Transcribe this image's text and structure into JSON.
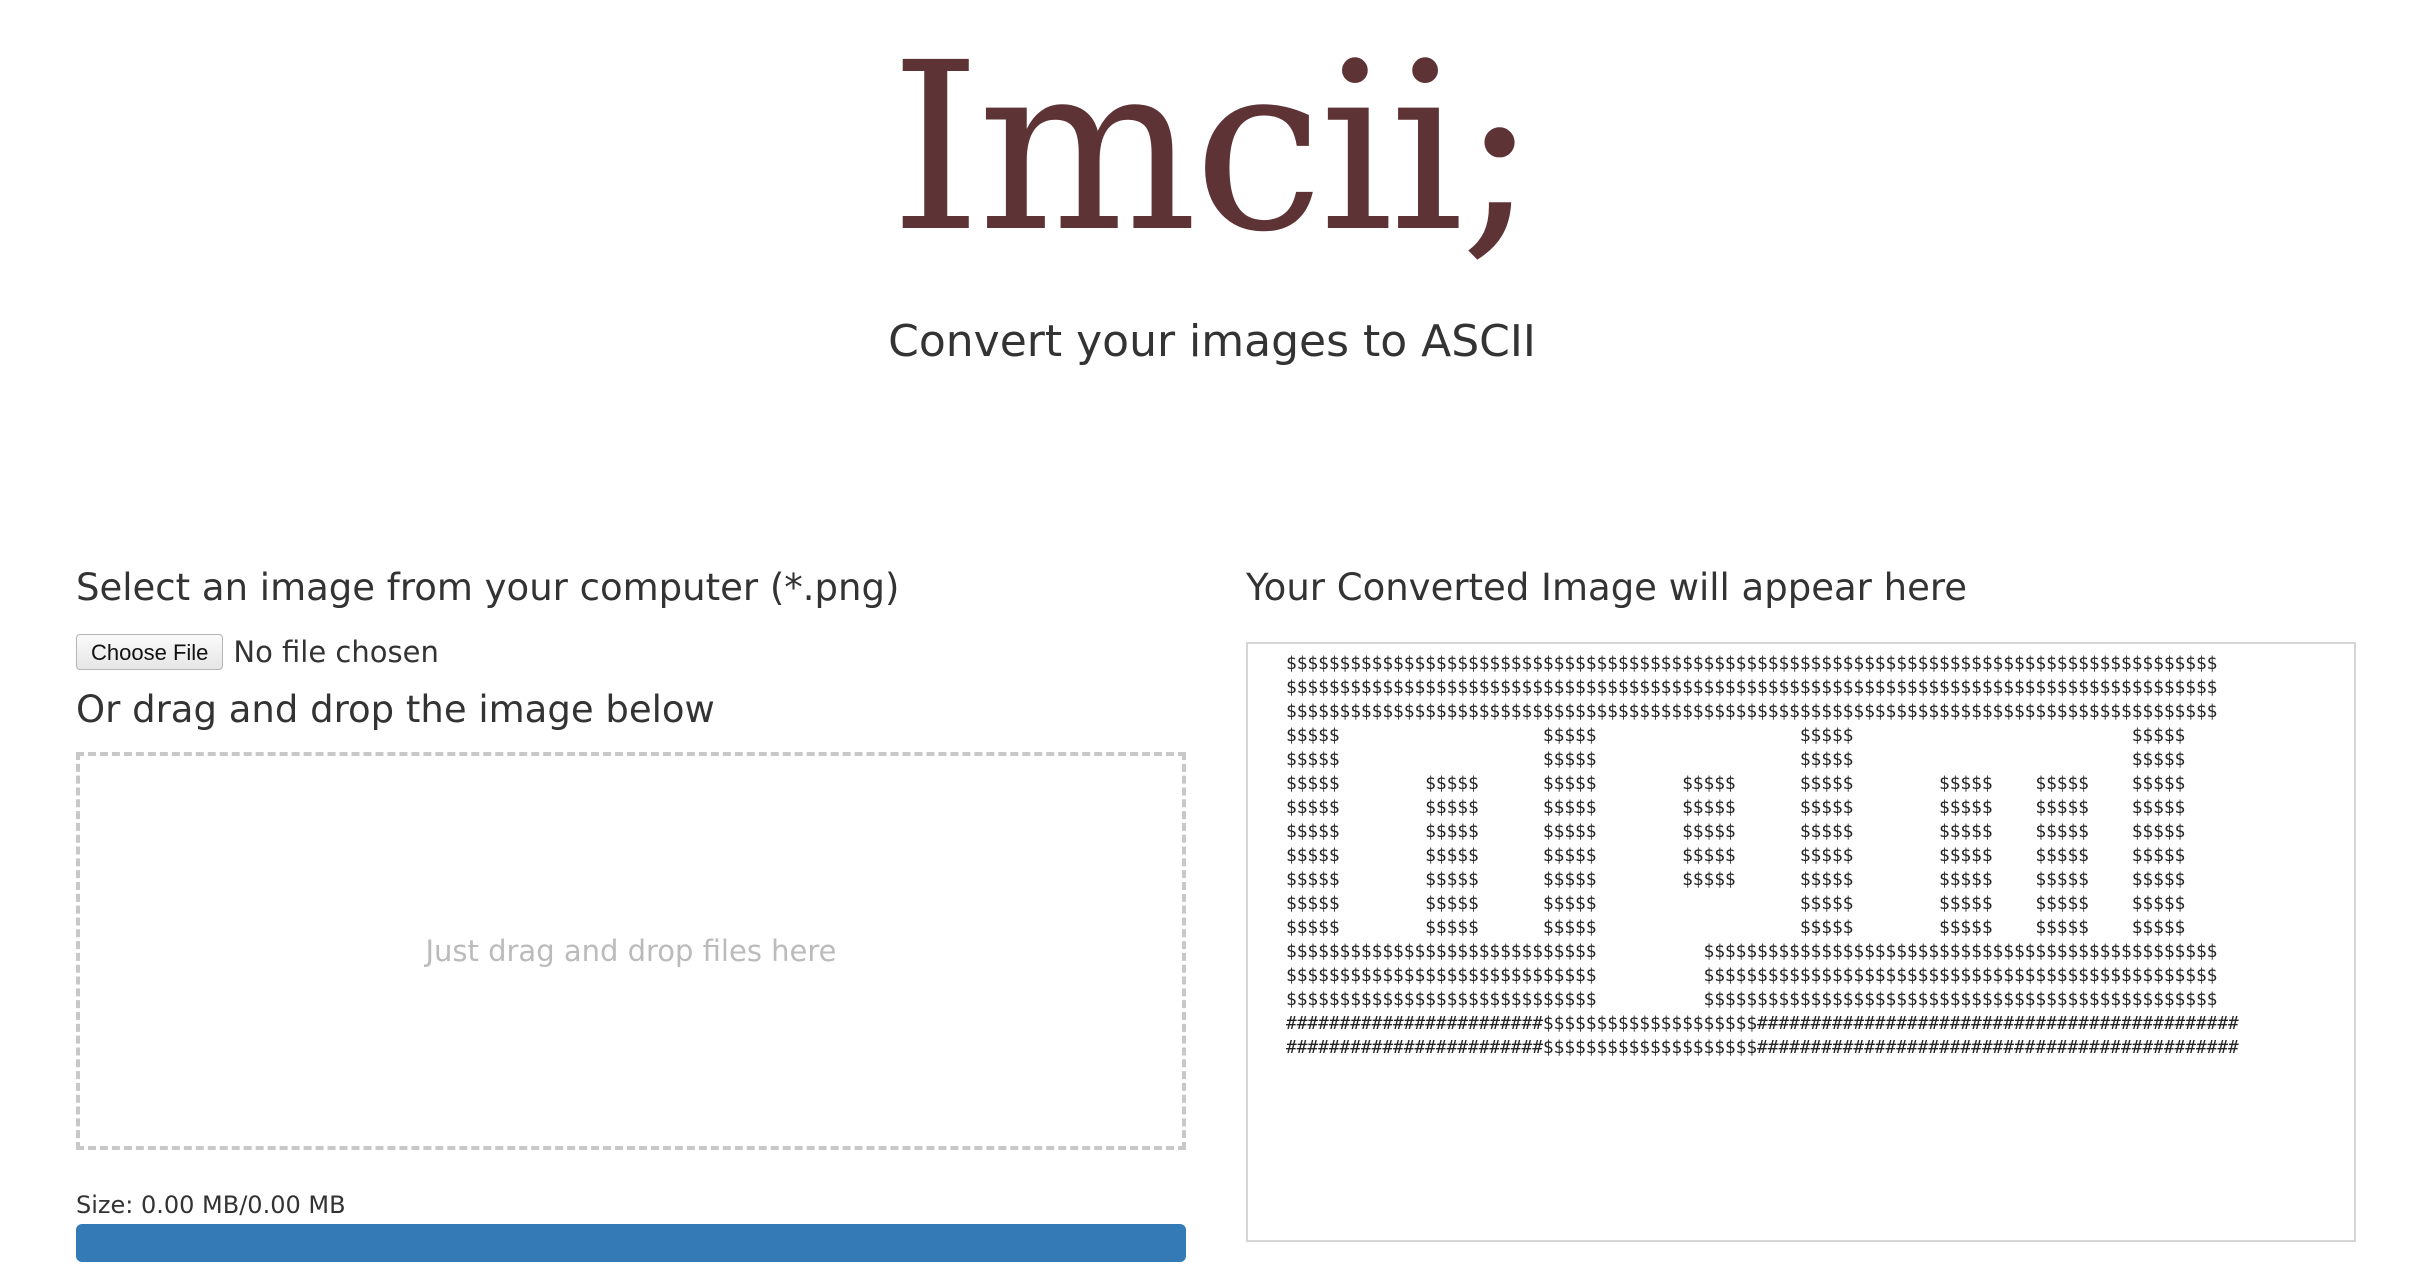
{
  "header": {
    "logo_text": "Imcii;",
    "tagline": "Convert your images to ASCII"
  },
  "upload": {
    "select_title": "Select an image from your computer (*.png)",
    "choose_file_label": "Choose File",
    "file_status": "No file chosen",
    "drag_title": "Or drag and drop the image below",
    "dropzone_hint": "Just drag and drop files here",
    "size_label": "Size: 0.00 MB/0.00 MB",
    "progress_fraction": 1.0
  },
  "output": {
    "title": "Your Converted Image will appear here",
    "ascii_lines": [
      "$$$$$$$$$$$$$$$$$$$$$$$$$$$$$$$$$$$$$$$$$$$$$$$$$$$$$$$$$$$$$$$$$$$$$$$$$$$$$$$$$$$$$$$",
      "$$$$$$$$$$$$$$$$$$$$$$$$$$$$$$$$$$$$$$$$$$$$$$$$$$$$$$$$$$$$$$$$$$$$$$$$$$$$$$$$$$$$$$$",
      "$$$$$$$$$$$$$$$$$$$$$$$$$$$$$$$$$$$$$$$$$$$$$$$$$$$$$$$$$$$$$$$$$$$$$$$$$$$$$$$$$$$$$$$",
      "$$$$$                   $$$$$                   $$$$$                          $$$$$",
      "$$$$$                   $$$$$                   $$$$$                          $$$$$",
      "$$$$$        $$$$$      $$$$$        $$$$$      $$$$$        $$$$$    $$$$$    $$$$$",
      "$$$$$        $$$$$      $$$$$        $$$$$      $$$$$        $$$$$    $$$$$    $$$$$",
      "$$$$$        $$$$$      $$$$$        $$$$$      $$$$$        $$$$$    $$$$$    $$$$$",
      "$$$$$        $$$$$      $$$$$        $$$$$      $$$$$        $$$$$    $$$$$    $$$$$",
      "$$$$$        $$$$$      $$$$$        $$$$$      $$$$$        $$$$$    $$$$$    $$$$$",
      "$$$$$        $$$$$      $$$$$                   $$$$$        $$$$$    $$$$$    $$$$$",
      "$$$$$        $$$$$      $$$$$                   $$$$$        $$$$$    $$$$$    $$$$$",
      "$$$$$$$$$$$$$$$$$$$$$$$$$$$$$          $$$$$$$$$$$$$$$$$$$$$$$$$$$$$$$$$$$$$$$$$$$$$$$$",
      "$$$$$$$$$$$$$$$$$$$$$$$$$$$$$          $$$$$$$$$$$$$$$$$$$$$$$$$$$$$$$$$$$$$$$$$$$$$$$$",
      "$$$$$$$$$$$$$$$$$$$$$$$$$$$$$          $$$$$$$$$$$$$$$$$$$$$$$$$$$$$$$$$$$$$$$$$$$$$$$$",
      "########################$$$$$$$$$$$$$$$$$$$$#############################################",
      "########################$$$$$$$$$$$$$$$$$$$$#############################################"
    ]
  },
  "colors": {
    "logo": "#5e3336",
    "progress": "#337ab7",
    "dropzone_border": "#c8c8c8"
  }
}
